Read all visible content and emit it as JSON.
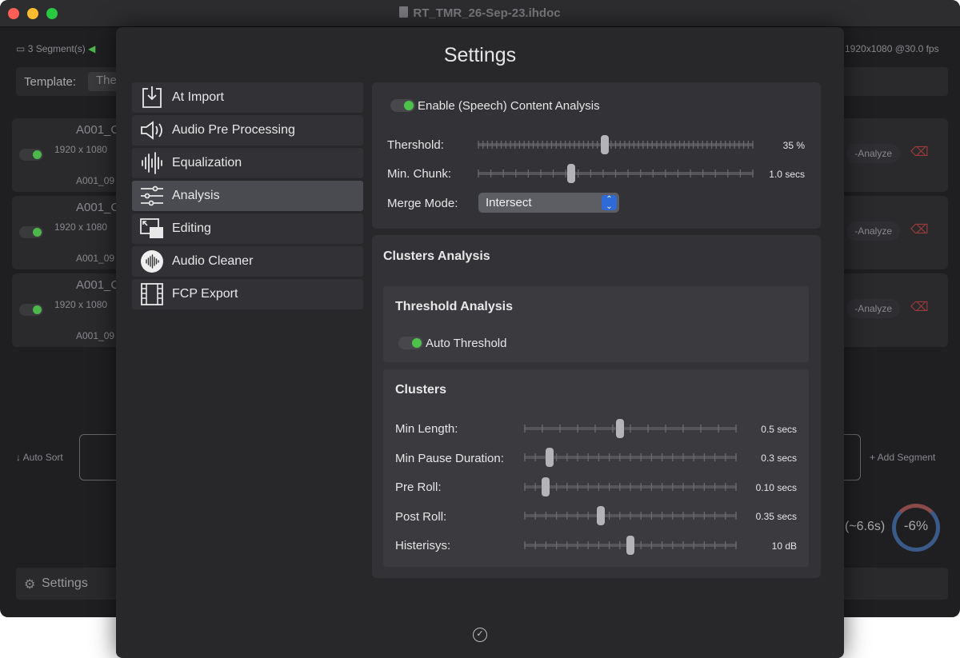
{
  "window": {
    "title": "RT_TMR_26-Sep-23.ihdoc"
  },
  "background": {
    "segments_count": "3 Segment(s)",
    "resolution_fps": "1920x1080 @30.0 fps",
    "template_label": "Template:",
    "template_value": "The",
    "rows": [
      {
        "clip": "A001_C",
        "size": "1920 x 1080",
        "audio": "A001_09",
        "analyze": "-Analyze"
      },
      {
        "clip": "A001_C",
        "size": "1920 x 1080",
        "audio": "A001_09",
        "analyze": "-Analyze"
      },
      {
        "clip": "A001_C",
        "size": "1920 x 1080",
        "audio": "A001_09",
        "analyze": "-Analyze"
      }
    ],
    "auto_sort": "↓ Auto Sort",
    "add_segment": "+ Add Segment",
    "duration": "(~6.6s)",
    "percent": "-6%",
    "settings_label": "Settings"
  },
  "dialog": {
    "title": "Settings",
    "nav": [
      {
        "label": "At Import",
        "icon": "import-tray-icon"
      },
      {
        "label": "Audio Pre Processing",
        "icon": "speaker-icon"
      },
      {
        "label": "Equalization",
        "icon": "waveform-icon"
      },
      {
        "label": "Analysis",
        "icon": "sliders-icon",
        "selected": true
      },
      {
        "label": "Editing",
        "icon": "editing-window-icon"
      },
      {
        "label": "Audio Cleaner",
        "icon": "audio-cleaner-icon"
      },
      {
        "label": "FCP Export",
        "icon": "film-strip-icon"
      }
    ],
    "analysis": {
      "enable_label": "Enable (Speech) Content Analysis",
      "enable_on": true,
      "threshold": {
        "label": "Thershold:",
        "value_text": "35 %",
        "position": 0.46
      },
      "min_chunk": {
        "label": "Min. Chunk:",
        "value_text": "1.0 secs",
        "position": 0.34
      },
      "merge_mode": {
        "label": "Merge Mode:",
        "value": "Intersect"
      }
    },
    "clusters_analysis": {
      "title": "Clusters Analysis",
      "threshold_analysis": {
        "title": "Threshold Analysis",
        "auto_label": "Auto Threshold",
        "auto_on": true
      },
      "clusters": {
        "title": "Clusters",
        "sliders": [
          {
            "label": "Min Length:",
            "value_text": "0.5 secs",
            "position": 0.45
          },
          {
            "label": "Min Pause Duration:",
            "value_text": "0.3 secs",
            "position": 0.12
          },
          {
            "label": "Pre Roll:",
            "value_text": "0.10 secs",
            "position": 0.1
          },
          {
            "label": "Post Roll:",
            "value_text": "0.35 secs",
            "position": 0.36
          },
          {
            "label": "Histerisys:",
            "value_text": "10 dB",
            "position": 0.5
          }
        ]
      }
    },
    "done_icon": "checkmark-circle-icon"
  }
}
